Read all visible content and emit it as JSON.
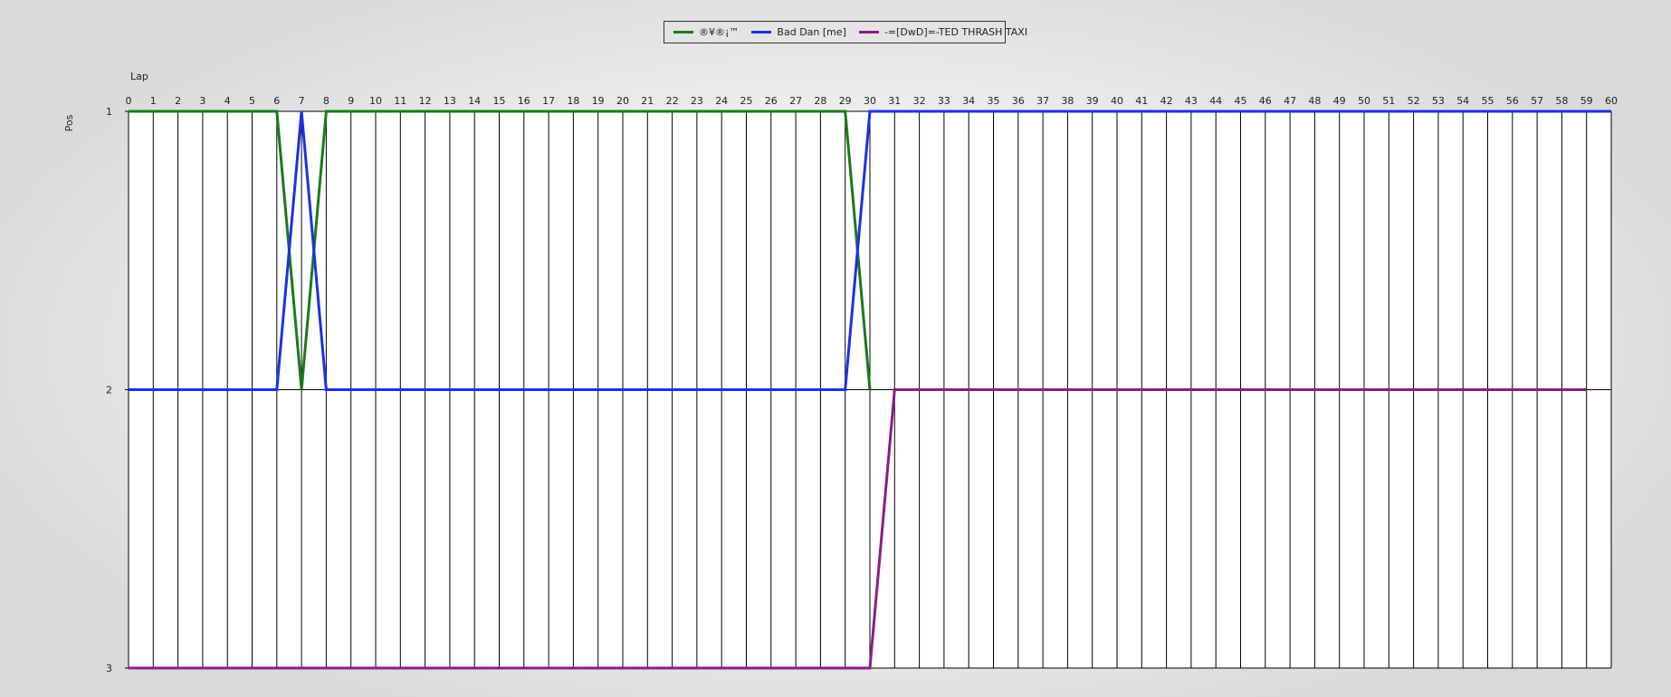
{
  "chart_data": {
    "type": "line",
    "xlabel": "Lap",
    "ylabel": "Pos",
    "xlim": [
      0,
      60
    ],
    "ylim": [
      1,
      3
    ],
    "y_inverted": true,
    "grid": "vertical",
    "legend_position": "top-center",
    "x_ticks": [
      0,
      1,
      2,
      3,
      4,
      5,
      6,
      7,
      8,
      9,
      10,
      11,
      12,
      13,
      14,
      15,
      16,
      17,
      18,
      19,
      20,
      21,
      22,
      23,
      24,
      25,
      26,
      27,
      28,
      29,
      30,
      31,
      32,
      33,
      34,
      35,
      36,
      37,
      38,
      39,
      40,
      41,
      42,
      43,
      44,
      45,
      46,
      47,
      48,
      49,
      50,
      51,
      52,
      53,
      54,
      55,
      56,
      57,
      58,
      59,
      60
    ],
    "y_ticks": [
      1,
      2,
      3
    ],
    "series": [
      {
        "name": "®¥®¡™",
        "color": "#1a7a1a",
        "points": [
          [
            0,
            1
          ],
          [
            6,
            1
          ],
          [
            7,
            2
          ],
          [
            8,
            1
          ],
          [
            29,
            1
          ],
          [
            30,
            2
          ]
        ]
      },
      {
        "name": "Bad Dan [me]",
        "color": "#1f2fe6",
        "points": [
          [
            0,
            2
          ],
          [
            6,
            2
          ],
          [
            7,
            1
          ],
          [
            8,
            2
          ],
          [
            29,
            2
          ],
          [
            30,
            1
          ],
          [
            60,
            1
          ]
        ]
      },
      {
        "name": "-=[DwD]=-TED THRASH TAXI",
        "color": "#8b1a8b",
        "points": [
          [
            0,
            3
          ],
          [
            30,
            3
          ],
          [
            31,
            2
          ],
          [
            59,
            2
          ]
        ]
      }
    ]
  }
}
